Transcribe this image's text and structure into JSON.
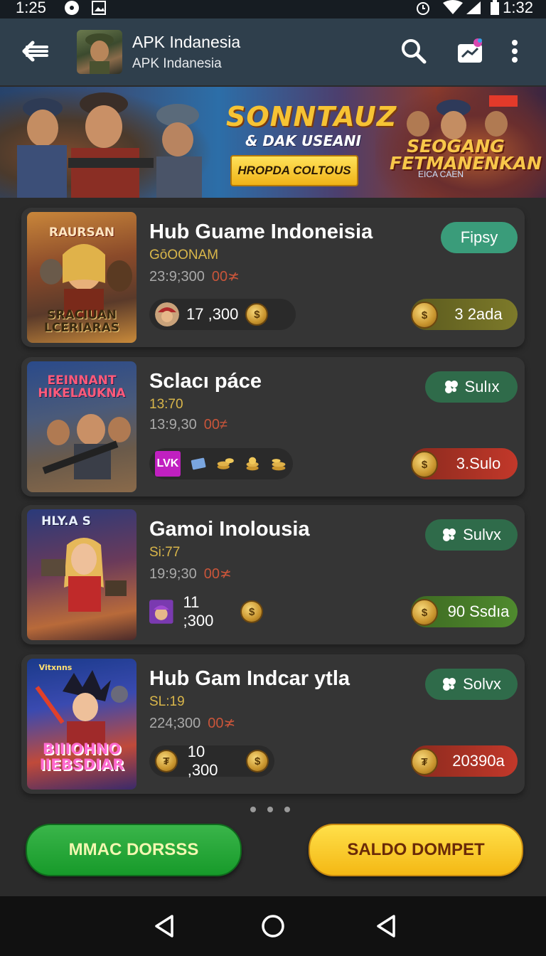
{
  "status_bar": {
    "time": "1:25",
    "right_time": "1:32"
  },
  "app_bar": {
    "title": "APK Indanesia",
    "subtitle": "APK Indanesia"
  },
  "banner": {
    "title": "SONNTAUZ",
    "subtitle": "& DAK USEANI",
    "button_label": "HROPDA COLTOUS",
    "right_title_1": "SEOGANG",
    "right_title_2": "FETMANENKAN",
    "right_sub": "EICA CAEN"
  },
  "cards": [
    {
      "title": "Hub Guame Indoneisia",
      "meta1": "GōOONAM",
      "meta2": "23:9;300",
      "meta2_red": "00≭",
      "tag": "Fipsy",
      "stat": "17 ,300",
      "amount": "3 2ada",
      "thumb_top": "RAURSAN",
      "thumb_bottom": "SRACIUAN LCERIARAS"
    },
    {
      "title": "Sclacı páce",
      "meta1": "13:70",
      "meta2": "13:9,30",
      "meta2_red": "00≠",
      "tag": "Sulıx",
      "stat_badge": "LVK",
      "amount": "3.Sulo",
      "thumb_top": "EEINNANT HIKELAUKNA"
    },
    {
      "title": "Gamoi Inolousia",
      "meta1": "Si:77",
      "meta2": "19:9;30",
      "meta2_red": "00≭",
      "tag": "Sulvx",
      "stat": "11 ;300",
      "amount": "90 Ssdıa",
      "thumb_top": "HLY.A S"
    },
    {
      "title": "Hub Gam Indcar ytla",
      "meta1": "SL:19",
      "meta2": "224;300",
      "meta2_red": "00≭",
      "tag": "Solvx",
      "stat": "10 ,300",
      "amount": "20390a",
      "thumb_top": "Vitxnns",
      "thumb_bottom": "BIIIOHNO IIEBSDIAR"
    }
  ],
  "buttons": {
    "left": "MMAC DORSSS",
    "right": "SALDO DOMPET"
  },
  "colors": {
    "accent_green": "#179a2a",
    "accent_yellow": "#f4b814",
    "app_bar": "#2f3f4c"
  }
}
